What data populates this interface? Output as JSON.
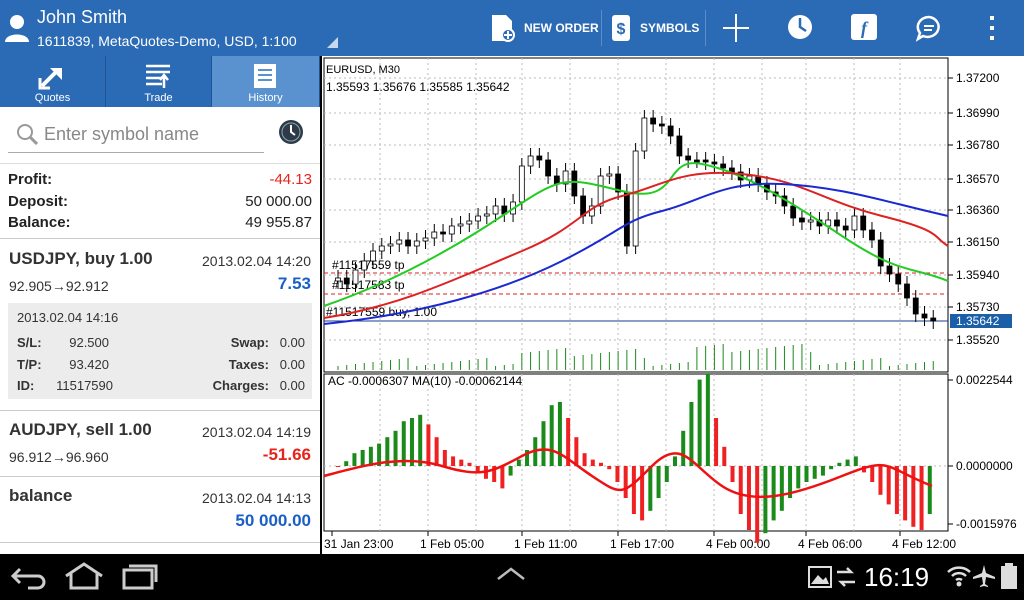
{
  "account": {
    "name": "John Smith",
    "details": "1611839, MetaQuotes-Demo, USD, 1:100"
  },
  "toolbar": {
    "new_order": "NEW ORDER",
    "symbols": "SYMBOLS"
  },
  "tabs": [
    {
      "label": "Quotes"
    },
    {
      "label": "Trade"
    },
    {
      "label": "History"
    }
  ],
  "search": {
    "placeholder": "Enter symbol name"
  },
  "summary": {
    "profit_label": "Profit:",
    "profit": "-44.13",
    "deposit_label": "Deposit:",
    "deposit": "50 000.00",
    "balance_label": "Balance:",
    "balance": "49 955.87"
  },
  "deals": [
    {
      "title": "USDJPY, buy 1.00",
      "time": "2013.02.04 14:20",
      "prices": "92.905→92.912",
      "pl": "7.53",
      "details": {
        "time": "2013.02.04 14:16",
        "sl_label": "S/L:",
        "sl": "92.500",
        "tp_label": "T/P:",
        "tp": "93.420",
        "id_label": "ID:",
        "id": "11517590",
        "swap_label": "Swap:",
        "swap": "0.00",
        "taxes_label": "Taxes:",
        "taxes": "0.00",
        "charges_label": "Charges:",
        "charges": "0.00"
      }
    },
    {
      "title": "AUDJPY, sell 1.00",
      "time": "2013.02.04 14:19",
      "prices": "96.912→96.960",
      "pl": "-51.66"
    },
    {
      "title": "balance",
      "time": "2013.02.04 14:13",
      "pl": "50 000.00"
    }
  ],
  "chart": {
    "symbol": "EURUSD, M30",
    "ohlc": "1.35593 1.35676 1.35585 1.35642",
    "levels": [
      "#11517559 tp",
      "#11517583 tp",
      "#11517559 buy, 1.00"
    ],
    "price_ticks": [
      "1.37200",
      "1.36990",
      "1.36780",
      "1.36570",
      "1.36360",
      "1.36150",
      "1.35940",
      "1.35730",
      "1.35520"
    ],
    "current_price": "1.35642",
    "indicator_label": "AC -0.0006307 MA(10) -0.00062144",
    "ind_ticks": [
      "0.0022544",
      "0.0000000",
      "-0.0015976"
    ],
    "time_ticks": [
      "31 Jan 23:00",
      "1 Feb 05:00",
      "1 Feb 11:00",
      "1 Feb 17:00",
      "4 Feb 00:00",
      "4 Feb 06:00",
      "4 Feb 12:00"
    ]
  },
  "status": {
    "time": "16:19"
  },
  "colors": {
    "header": "#2b6ab4",
    "loss": "#e8231b",
    "profit": "#1a5fc7",
    "ma_green": "#22cc22",
    "ma_red": "#dd2222",
    "ma_blue": "#1a2ad0"
  }
}
